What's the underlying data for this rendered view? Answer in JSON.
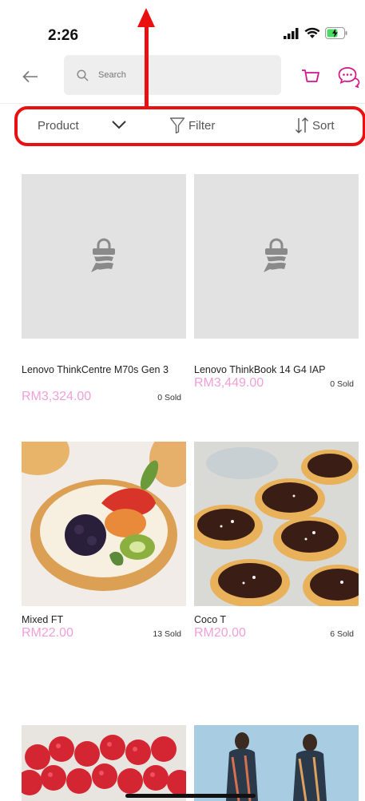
{
  "status": {
    "time": "2:26"
  },
  "search": {
    "placeholder": "Search"
  },
  "filter_bar": {
    "product_label": "Product",
    "filter_label": "Filter",
    "sort_label": "Sort"
  },
  "colors": {
    "accent": "#d4148c",
    "price": "#f0a0d8",
    "highlight": "#e81010"
  },
  "products": [
    {
      "title": "Lenovo ThinkCentre M70s Gen 3",
      "price": "RM3,324.00",
      "sold": "0 Sold",
      "image": "placeholder-bag"
    },
    {
      "title": "Lenovo ThinkBook 14 G4 IAP",
      "price": "RM3,449.00",
      "sold": "0 Sold",
      "image": "placeholder-bag"
    },
    {
      "title": "Mixed FT",
      "price": "RM22.00",
      "sold": "13 Sold",
      "image": "fruit-tart"
    },
    {
      "title": "Coco T",
      "price": "RM20.00",
      "sold": "6 Sold",
      "image": "chocolate-tart"
    },
    {
      "title": "",
      "price": "",
      "sold": "",
      "image": "raspberry-tart"
    },
    {
      "title": "",
      "price": "",
      "sold": "",
      "image": "fashion-models"
    }
  ]
}
